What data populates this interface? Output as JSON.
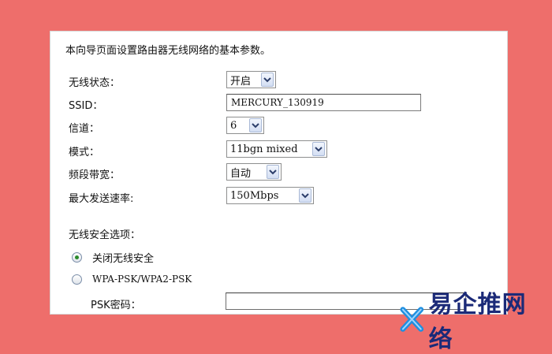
{
  "intro": "本向导页面设置路由器无线网络的基本参数。",
  "fields": {
    "wireless_status": {
      "label": "无线状态：",
      "value": "开启"
    },
    "ssid": {
      "label": "SSID：",
      "value": "MERCURY_130919"
    },
    "channel": {
      "label": "信道：",
      "value": "6"
    },
    "mode": {
      "label": "模式：",
      "value": "11bgn mixed"
    },
    "bandwidth": {
      "label": "频段带宽：",
      "value": "自动"
    },
    "max_rate": {
      "label": "最大发送速率:",
      "value": "150Mbps"
    }
  },
  "security": {
    "title": "无线安全选项：",
    "options": [
      {
        "label": "关闭无线安全",
        "selected": true
      },
      {
        "label": "WPA-PSK/WPA2-PSK",
        "selected": false
      }
    ],
    "psk_label": "PSK密码：",
    "psk_value": ""
  },
  "watermark": {
    "text": "易企推网络"
  },
  "colors": {
    "background": "#ee6e6b",
    "watermark": "#1b2a78",
    "radio_selected": "#2a8a2a"
  }
}
